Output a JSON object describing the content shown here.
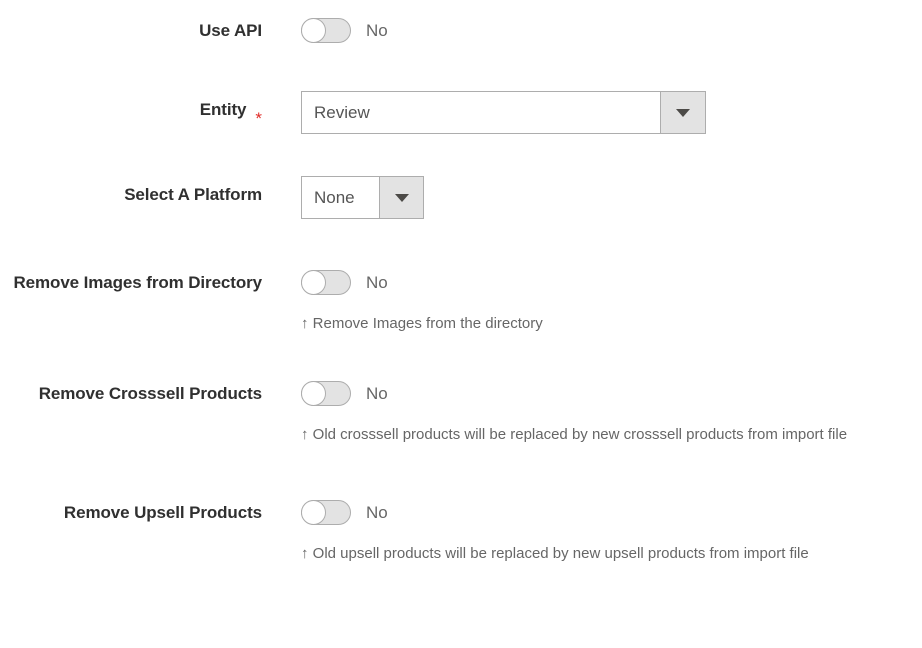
{
  "form": {
    "fields": [
      {
        "id": "use-api",
        "label": "Use API",
        "type": "toggle",
        "value": "No",
        "required": false,
        "hint": ""
      },
      {
        "id": "entity",
        "label": "Entity",
        "type": "select",
        "value": "Review",
        "required": true,
        "required_marker": "*",
        "hint": ""
      },
      {
        "id": "select-a-platform",
        "label": "Select A Platform",
        "type": "select",
        "value": "None",
        "required": false,
        "hint": ""
      },
      {
        "id": "remove-images-from-directory",
        "label": "Remove Images from Directory",
        "type": "toggle",
        "value": "No",
        "required": false,
        "hint": "↑ Remove Images from the directory"
      },
      {
        "id": "remove-crosssell-products",
        "label": "Remove Crosssell Products",
        "type": "toggle",
        "value": "No",
        "required": false,
        "hint": "↑ Old crosssell products will be replaced by new crosssell products from import file"
      },
      {
        "id": "remove-upsell-products",
        "label": "Remove Upsell Products",
        "type": "toggle",
        "value": "No",
        "required": false,
        "hint": "↑ Old upsell products will be replaced by new upsell products from import file"
      }
    ]
  },
  "icons": {
    "dropdown_caret": "chevron-down-icon",
    "toggle_knob": "toggle-knob-icon"
  },
  "colors": {
    "label_text": "#303030",
    "value_text": "#555555",
    "hint_text": "#666666",
    "required_star": "#e02b27",
    "border": "#adadad",
    "control_fill": "#e3e3e3",
    "background": "#ffffff"
  }
}
